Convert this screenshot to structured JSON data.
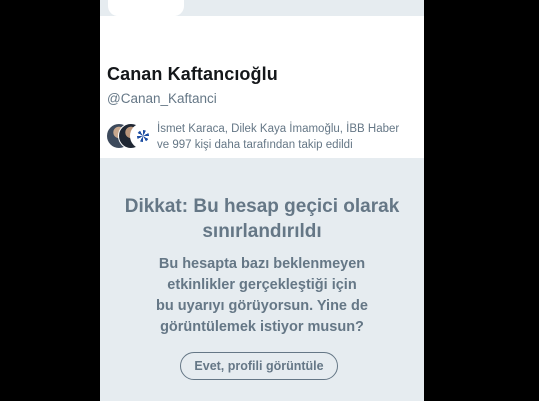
{
  "profile": {
    "display_name": "Canan Kaftancıoğlu",
    "handle": "@Canan_Kaftanci"
  },
  "followed_by": {
    "text_line1": "İsmet Karaca, Dilek Kaya İmamoğlu, İBB Haber",
    "text_line2": "ve 997 kişi daha tarafından takip edildi"
  },
  "notice": {
    "title_line1": "Dikkat: Bu hesap geçici olarak",
    "title_line2": "sınırlandırıldı",
    "body_line1": "Bu hesapta bazı beklenmeyen",
    "body_line2": "etkinlikler gerçekleştiği için",
    "body_line3": "bu uyarıyı görüyorsun. Yine de",
    "body_line4": "görüntülemek istiyor musun?",
    "button_label": "Evet, profili görüntüle"
  },
  "colors": {
    "background": "#000000",
    "panel": "#ffffff",
    "notice_bg": "#e6ecf0",
    "primary_text": "#14171a",
    "secondary_text": "#657786"
  },
  "icons": [
    "follower-avatar",
    "follower-avatar",
    "ibb-logo-icon"
  ]
}
